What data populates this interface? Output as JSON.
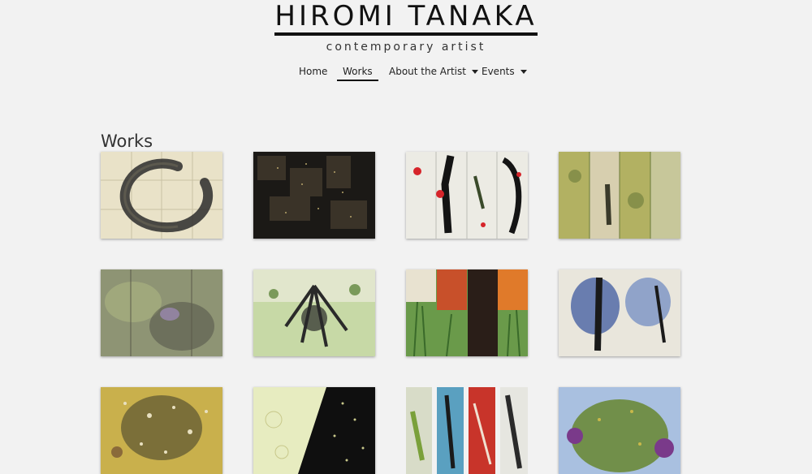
{
  "site": {
    "title": "HIROMI TANAKA",
    "tagline": "contemporary artist"
  },
  "nav": {
    "items": [
      {
        "label": "Home"
      },
      {
        "label": "Works",
        "active": true
      },
      {
        "label": "About the Artist",
        "dropdown": true
      },
      {
        "label": "Events",
        "dropdown": true
      }
    ]
  },
  "page": {
    "heading": "Works"
  },
  "gallery": {
    "items": [
      {
        "name": "artwork-ensō-circle",
        "colors": [
          "#e9e2c8",
          "#2b2b2b",
          "#8a8574"
        ]
      },
      {
        "name": "artwork-dark-grid",
        "colors": [
          "#1b1916",
          "#3a3328",
          "#b8a66a"
        ]
      },
      {
        "name": "artwork-red-dots-panels",
        "colors": [
          "#ecebe4",
          "#141414",
          "#d6242a"
        ]
      },
      {
        "name": "artwork-green-panels",
        "colors": [
          "#b2b162",
          "#6a7a3a",
          "#e7dcd0"
        ]
      },
      {
        "name": "artwork-lavender-texture",
        "colors": [
          "#8e9474",
          "#3d3a3a",
          "#9a88b0"
        ]
      },
      {
        "name": "artwork-green-burst",
        "colors": [
          "#c7d9a6",
          "#2a2a2a",
          "#f1eee6"
        ]
      },
      {
        "name": "artwork-orange-grass",
        "colors": [
          "#6a9a4a",
          "#c8502a",
          "#2a1e18"
        ]
      },
      {
        "name": "artwork-blue-splash",
        "colors": [
          "#e9e6dc",
          "#3d5aa0",
          "#1a1a1a"
        ]
      },
      {
        "name": "artwork-ochre-speckle",
        "colors": [
          "#c9b04c",
          "#3a3a2a",
          "#8a6a3a"
        ]
      },
      {
        "name": "artwork-black-wedge",
        "colors": [
          "#e7ecc0",
          "#0f0f0f",
          "#c8c88a"
        ]
      },
      {
        "name": "artwork-four-strips",
        "colors": [
          "#5aa0c0",
          "#c8342a",
          "#2a2a2a"
        ]
      },
      {
        "name": "artwork-purple-blossoms",
        "colors": [
          "#6a8a3a",
          "#a9c0e0",
          "#7a3a8a"
        ]
      }
    ]
  }
}
